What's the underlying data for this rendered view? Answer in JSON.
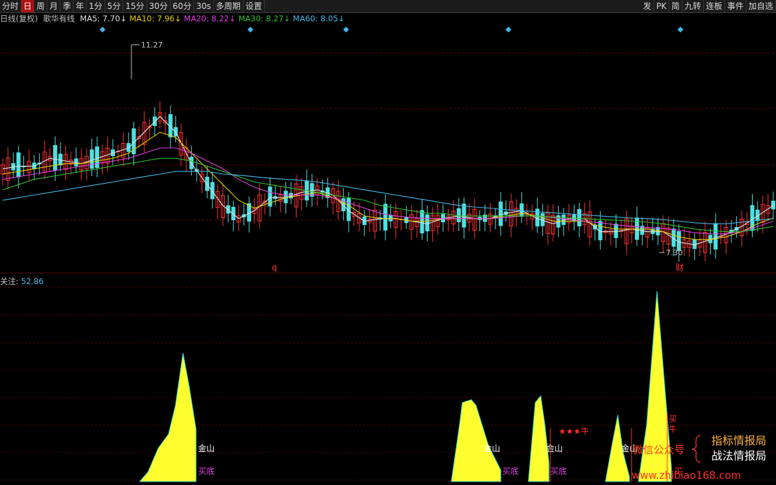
{
  "toolbar": {
    "items": [
      "分时",
      "日",
      "周",
      "月",
      "季",
      "年",
      "1分",
      "5分",
      "15分",
      "30分",
      "60分",
      "30s",
      "多周期",
      "设置"
    ],
    "active_index": 1,
    "right_items": [
      "发",
      "PK",
      "简",
      "九转",
      "连板",
      "事件",
      "加自选"
    ]
  },
  "info": {
    "title": "日线(复权)",
    "indicator_name": "歌华有线",
    "ma": [
      {
        "label": "MA5: 7.70",
        "arrow": "↓",
        "color": "#e0e0e0"
      },
      {
        "label": "MA10: 7.96",
        "arrow": "↓",
        "color": "#e8d000"
      },
      {
        "label": "MA20: 8.22",
        "arrow": "↓",
        "color": "#e040e0"
      },
      {
        "label": "MA30: 8.27",
        "arrow": "↓",
        "color": "#30c030"
      },
      {
        "label": "MA60: 8.05",
        "arrow": "↓",
        "color": "#40b8e8"
      }
    ]
  },
  "colors": {
    "up": "#ff3030",
    "down": "#4ee0e0",
    "ma5": "#e0e0e0",
    "ma10": "#e8d000",
    "ma20": "#e040e0",
    "ma30": "#30c030",
    "ma60": "#40b8e8",
    "fill": "#ffff30"
  },
  "chart_data": [
    {
      "type": "line",
      "title": "日线(复权)",
      "ylim": [
        7.0,
        11.6
      ],
      "high_label": "11.27",
      "low_label": "7.30",
      "markers": [
        "q",
        "财"
      ],
      "series": [
        {
          "name": "MA5",
          "values": [
            8.9,
            8.95,
            8.95,
            9.1,
            9.05,
            9.0,
            9.1,
            9.2,
            9.3,
            9.6,
            9.9,
            9.6,
            9.0,
            8.6,
            8.2,
            7.95,
            8.1,
            8.35,
            8.35,
            8.45,
            8.5,
            8.4,
            8.1,
            7.9,
            7.95,
            7.95,
            7.9,
            7.85,
            7.95,
            8.0,
            7.95,
            7.95,
            8.05,
            8.1,
            7.95,
            7.85,
            7.95,
            7.95,
            7.7,
            7.7,
            7.75,
            7.7,
            7.7,
            7.5,
            7.45,
            7.55,
            7.65,
            7.8,
            8.0,
            8.2
          ]
        },
        {
          "name": "MA10",
          "values": [
            8.8,
            8.85,
            8.9,
            8.95,
            9.0,
            9.0,
            9.05,
            9.1,
            9.2,
            9.4,
            9.6,
            9.5,
            9.2,
            8.9,
            8.6,
            8.3,
            8.15,
            8.25,
            8.35,
            8.4,
            8.45,
            8.35,
            8.2,
            8.0,
            7.95,
            7.95,
            7.9,
            7.9,
            7.95,
            7.95,
            7.95,
            7.95,
            8.0,
            8.05,
            8.0,
            7.9,
            7.9,
            7.9,
            7.8,
            7.75,
            7.75,
            7.75,
            7.7,
            7.6,
            7.55,
            7.55,
            7.6,
            7.7,
            7.85,
            7.96
          ]
        },
        {
          "name": "MA20",
          "values": [
            8.7,
            8.75,
            8.8,
            8.85,
            8.9,
            8.95,
            9.0,
            9.05,
            9.1,
            9.2,
            9.3,
            9.3,
            9.2,
            9.05,
            8.9,
            8.7,
            8.55,
            8.45,
            8.4,
            8.4,
            8.4,
            8.35,
            8.25,
            8.15,
            8.05,
            8.0,
            7.97,
            7.95,
            7.95,
            7.95,
            7.95,
            7.95,
            7.97,
            8.0,
            8.0,
            7.97,
            7.93,
            7.9,
            7.87,
            7.83,
            7.8,
            7.78,
            7.76,
            7.73,
            7.68,
            7.66,
            7.66,
            7.7,
            7.8,
            7.9
          ]
        },
        {
          "name": "MA30",
          "values": [
            8.5,
            8.6,
            8.7,
            8.75,
            8.8,
            8.85,
            8.9,
            8.95,
            9.0,
            9.05,
            9.1,
            9.1,
            9.05,
            8.95,
            8.85,
            8.75,
            8.65,
            8.6,
            8.55,
            8.5,
            8.45,
            8.4,
            8.35,
            8.3,
            8.2,
            8.15,
            8.1,
            8.05,
            8.05,
            8.0,
            8.0,
            8.0,
            8.0,
            8.0,
            8.0,
            7.98,
            7.96,
            7.95,
            7.93,
            7.92,
            7.9,
            7.88,
            7.85,
            7.8,
            7.75,
            7.72,
            7.7,
            7.7,
            7.75,
            7.8
          ]
        },
        {
          "name": "MA60",
          "values": [
            8.3,
            8.35,
            8.4,
            8.45,
            8.5,
            8.55,
            8.6,
            8.65,
            8.7,
            8.75,
            8.8,
            8.85,
            8.85,
            8.85,
            8.8,
            8.78,
            8.75,
            8.72,
            8.7,
            8.68,
            8.65,
            8.6,
            8.55,
            8.5,
            8.45,
            8.4,
            8.35,
            8.3,
            8.25,
            8.2,
            8.17,
            8.15,
            8.12,
            8.1,
            8.08,
            8.06,
            8.04,
            8.02,
            8.0,
            7.98,
            7.96,
            7.95,
            7.93,
            7.9,
            7.87,
            7.85,
            7.85,
            7.88,
            7.92,
            7.95
          ]
        }
      ]
    },
    {
      "type": "area",
      "title": "关注",
      "current_value": "52.86",
      "ylim": [
        0,
        130
      ],
      "segments": [
        {
          "x": [
            203,
            215,
            230,
            245,
            255,
            266,
            275,
            285
          ],
          "y": [
            0,
            10,
            35,
            50,
            80,
            135,
            100,
            55
          ]
        },
        {
          "x": [
            656,
            668,
            672,
            685,
            692,
            710,
            728
          ],
          "y": [
            0,
            60,
            83,
            86,
            80,
            38,
            12
          ]
        },
        {
          "x": [
            768,
            778,
            786,
            792,
            798
          ],
          "y": [
            0,
            83,
            90,
            60,
            20
          ]
        },
        {
          "x": [
            880,
            890,
            898,
            906,
            915
          ],
          "y": [
            0,
            40,
            70,
            30,
            5
          ]
        },
        {
          "x": [
            928,
            940,
            955,
            968,
            976
          ],
          "y": [
            0,
            60,
            200,
            85,
            15
          ]
        }
      ],
      "annotations": [
        "金山",
        "买底",
        "金山",
        "买底",
        "金山",
        "买底",
        "★★★牛",
        "金山",
        "买",
        "牛",
        "买"
      ]
    }
  ],
  "watermark": {
    "wechat": "微信公众号",
    "line1": "指标情报局",
    "line2": "战法情报局",
    "site": "www.zhibiao168.com"
  }
}
